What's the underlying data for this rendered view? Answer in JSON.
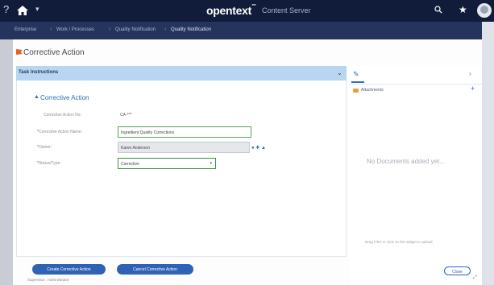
{
  "topbar": {
    "help_glyph": "?",
    "brand": "opentext",
    "brand_mark": "™",
    "product": "Content Server",
    "menu_caret": "▾",
    "star_glyph": "★"
  },
  "breadcrumb": [
    "Enterprise",
    "Work / Processes",
    "Quality Notification",
    "Quality Notification"
  ],
  "page": {
    "title": "Corrective Action"
  },
  "task": {
    "header_label": "Task Instructions",
    "collapse_glyph": "⌄"
  },
  "section": {
    "title": "Corrective Action",
    "caret": "▲"
  },
  "form": {
    "fields": [
      {
        "label": "Corrective Action No:",
        "required": false,
        "value": "CA-***"
      },
      {
        "label": "Corrective Action Name:",
        "required": true,
        "value": "Ingredient Quality Corrections"
      },
      {
        "label": "Owner:",
        "required": true,
        "value": "Karen Anderson"
      },
      {
        "label": "Status/Type:",
        "required": true,
        "value": "Corrective"
      }
    ],
    "required_marker": "*",
    "select_arrow": "▾",
    "owner_icons": "● ✚ ▲"
  },
  "documents_panel": {
    "tab_icon": "✎",
    "nav_arrow": "›",
    "folder_label": "Attachments",
    "add_glyph": "+",
    "empty_message": "No Documents added yet...",
    "drop_hint": "Drag Files or click on the widget to upload"
  },
  "buttons": {
    "create": "Create Corrective Action",
    "cancel": "Cancel Corrective Action",
    "close": "Close"
  },
  "footer": {
    "text": "Supervisor : Administrator",
    "resize_glyph": "⤢"
  },
  "colors": {
    "topbar": "#101c3a",
    "crumbbar": "#24345c",
    "accent": "#2f62b4",
    "task_header": "#b9d6f0",
    "flag": "#e8602c"
  },
  "icons": {
    "home": "home-icon",
    "search": "search-icon",
    "favorite": "star-icon",
    "profile": "avatar-icon",
    "attachment": "pencil-icon",
    "folder": "folder-icon"
  }
}
